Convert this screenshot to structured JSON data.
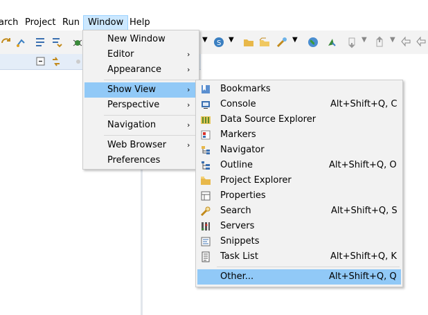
{
  "menubar": {
    "items": [
      {
        "label": "arch"
      },
      {
        "label": "Project"
      },
      {
        "label": "Run"
      },
      {
        "label": "Window"
      },
      {
        "label": "Help"
      }
    ]
  },
  "window_menu": {
    "items": [
      {
        "label": "New Window"
      },
      {
        "label": "Editor",
        "arrow": "›"
      },
      {
        "label": "Appearance",
        "arrow": "›"
      },
      {
        "label": "Show View",
        "arrow": "›"
      },
      {
        "label": "Perspective",
        "arrow": "›"
      },
      {
        "label": "Navigation",
        "arrow": "›"
      },
      {
        "label": "Web Browser",
        "arrow": "›"
      },
      {
        "label": "Preferences"
      }
    ]
  },
  "show_view_menu": {
    "items": [
      {
        "label": "Bookmarks",
        "icon": "bookmarks-icon",
        "shortcut": ""
      },
      {
        "label": "Console",
        "icon": "console-icon",
        "shortcut": "Alt+Shift+Q, C"
      },
      {
        "label": "Data Source Explorer",
        "icon": "data-source-explorer-icon",
        "shortcut": ""
      },
      {
        "label": "Markers",
        "icon": "markers-icon",
        "shortcut": ""
      },
      {
        "label": "Navigator",
        "icon": "navigator-icon",
        "shortcut": ""
      },
      {
        "label": "Outline",
        "icon": "outline-icon",
        "shortcut": "Alt+Shift+Q, O"
      },
      {
        "label": "Project Explorer",
        "icon": "project-explorer-icon",
        "shortcut": ""
      },
      {
        "label": "Properties",
        "icon": "properties-icon",
        "shortcut": ""
      },
      {
        "label": "Search",
        "icon": "search-icon",
        "shortcut": "Alt+Shift+Q, S"
      },
      {
        "label": "Servers",
        "icon": "servers-icon",
        "shortcut": ""
      },
      {
        "label": "Snippets",
        "icon": "snippets-icon",
        "shortcut": ""
      },
      {
        "label": "Task List",
        "icon": "task-list-icon",
        "shortcut": "Alt+Shift+Q, K"
      },
      {
        "label": "Other...",
        "icon": "",
        "shortcut": "Alt+Shift+Q, Q"
      }
    ]
  },
  "colors": {
    "highlight": "#91c9f7",
    "menu_bg": "#f2f2f2",
    "active_menubar": "#cce8ff"
  }
}
